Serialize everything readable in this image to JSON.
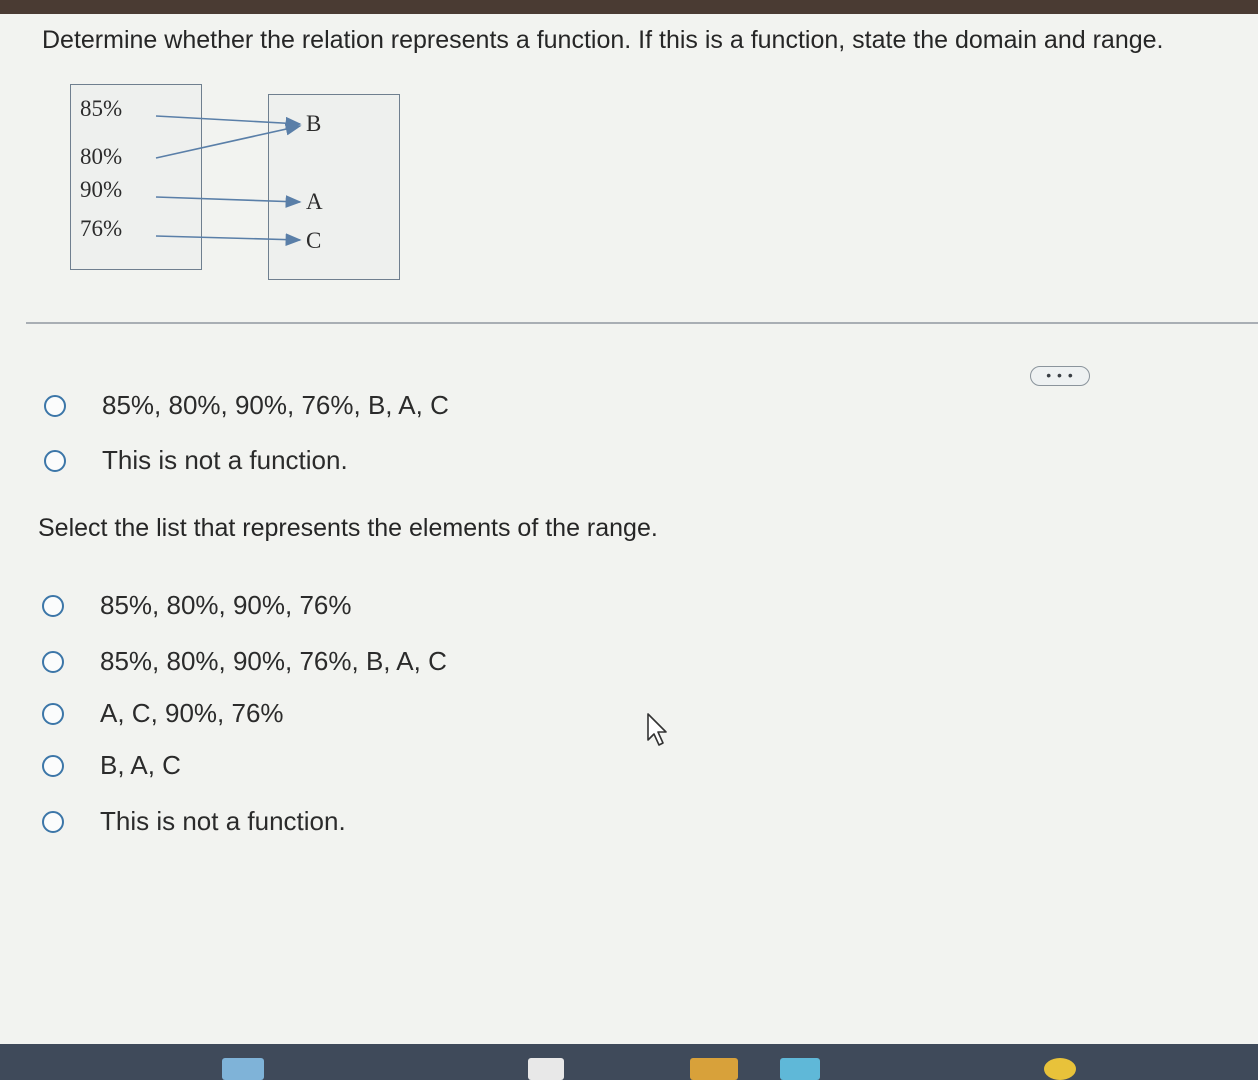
{
  "question": {
    "text": "Determine whether the relation represents a function. If this is a function, state the domain and range."
  },
  "mapping": {
    "domain": [
      "85%",
      "80%",
      "90%",
      "76%"
    ],
    "range": [
      "B",
      "A",
      "C"
    ],
    "pairs": [
      [
        "85%",
        "B"
      ],
      [
        "80%",
        "B"
      ],
      [
        "90%",
        "A"
      ],
      [
        "76%",
        "C"
      ]
    ]
  },
  "more_button": {
    "label": "• • •"
  },
  "part1": {
    "options": [
      "85%, 80%, 90%, 76%, B, A, C",
      "This is not a function."
    ]
  },
  "part2": {
    "prompt": "Select the list that represents the elements of the range.",
    "options": [
      "85%, 80%, 90%, 76%",
      "85%, 80%, 90%, 76%, B, A, C",
      "A, C, 90%, 76%",
      "B, A, C",
      "This is not a function."
    ]
  },
  "colors": {
    "radio_border": "#3c76a8",
    "arrow": "#5a7fa8",
    "box_border": "#6f7f8f"
  }
}
